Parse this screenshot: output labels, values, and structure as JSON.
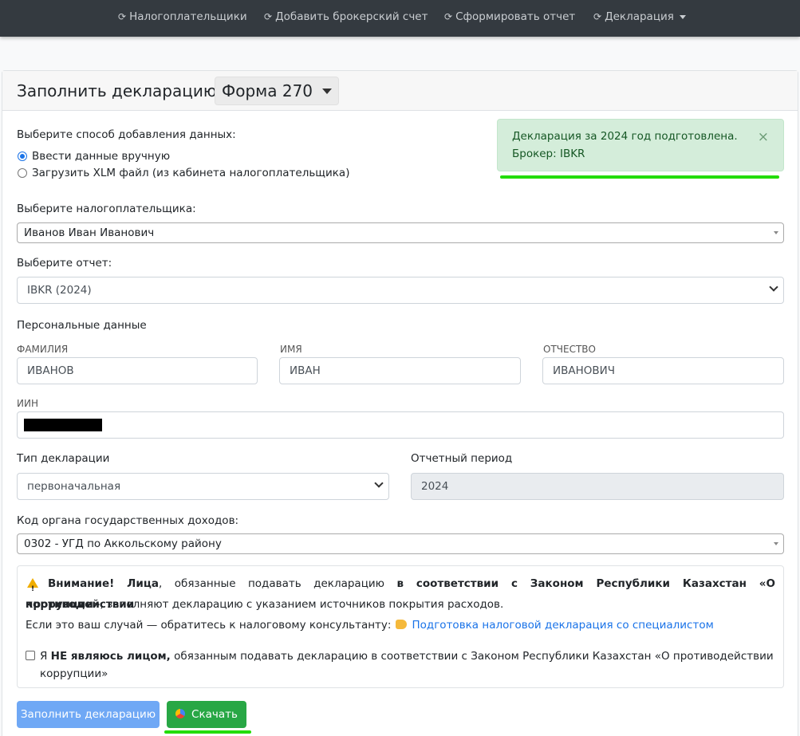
{
  "nav": {
    "items": [
      "Налогоплательщики",
      "Добавить брокерский счет",
      "Сформировать отчет",
      "Декларация"
    ]
  },
  "header": {
    "title": "Заполнить декларацию",
    "form_selector": "Форма 270"
  },
  "data_source": {
    "label": "Выберите способ добавления данных:",
    "options": [
      "Ввести данные вручную",
      "Загрузить XLM файл (из кабинета налогоплательщика)"
    ],
    "selected_index": 0
  },
  "alert": {
    "line1": "Декларация за 2024 год подготовлена.",
    "line2": "Брокер: IBKR",
    "close": "×"
  },
  "taxpayer": {
    "label": "Выберите налогоплательщика:",
    "value": "Иванов Иван Иванович"
  },
  "report": {
    "label": "Выберите отчет:",
    "value": "IBKR (2024)"
  },
  "personal": {
    "section_label": "Персональные данные",
    "surname_label": "ФАМИЛИЯ",
    "surname_value": "ИВАНОВ",
    "name_label": "ИМЯ",
    "name_value": "ИВАН",
    "patronymic_label": "ОТЧЕСТВО",
    "patronymic_value": "ИВАНОВИЧ",
    "iin_label": "ИИН"
  },
  "declaration_type": {
    "label": "Тип декларации",
    "value": "первоначальная"
  },
  "period": {
    "label": "Отчетный период",
    "value": "2024"
  },
  "tax_office": {
    "label": "Код органа государственных доходов:",
    "value": "0302 - УГД по Аккольскому району"
  },
  "notice": {
    "warning_bold": "Внимание! Лица",
    "text1": ", обязанные подавать декларацию ",
    "law_bold": "в соответствии с Законом Республики Казахстан «О противодействии",
    "law_bold2": "коррупции»",
    "text2": ", заполняют декларацию с указанием источников покрытия расходов.",
    "text3": "Если это ваш случай — обратитесь к налоговому консультанту:",
    "link": "Подготовка налоговой декларация со специалистом",
    "checkbox_prefix": "Я ",
    "checkbox_bold": "НЕ являюсь лицом,",
    "checkbox_text": " обязанным подавать декларацию в соответствии с Законом Республики Казахстан «О противодействии",
    "checkbox_text2": "коррупции»"
  },
  "actions": {
    "fill_label": "Заполнить декларацию",
    "download_label": "Скачать"
  },
  "colors": {
    "navbar": "#343a40",
    "success": "#28a745",
    "primary_disabled": "#6fa8f5",
    "alert_bg": "#d4edda",
    "highlight": "#22dd00"
  }
}
